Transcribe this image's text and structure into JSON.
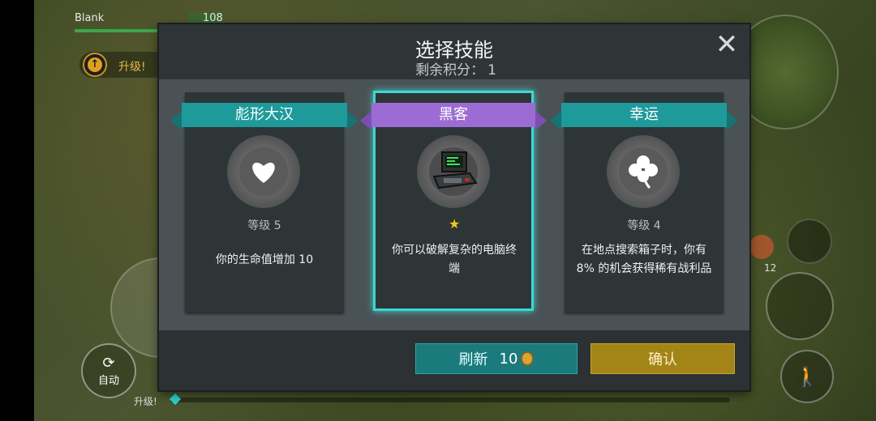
{
  "hud": {
    "player_name": "Blank",
    "hp_value": "108",
    "level_up_label": "升级!",
    "auto_label": "自动",
    "xp_label": "升级!",
    "item_count": "12"
  },
  "dialog": {
    "title": "选择技能",
    "points_label": "剩余积分：",
    "points_value": "1",
    "refresh_label": "刷新",
    "refresh_cost": "10",
    "confirm_label": "确认"
  },
  "cards": [
    {
      "name": "彪形大汉",
      "level": "等级 5",
      "description": "你的生命值增加 10",
      "icon": "heart-icon",
      "ribbon_color": "#1e9a9a"
    },
    {
      "name": "黑客",
      "level": "",
      "description_line1": "你可以破解复杂的电脑终",
      "description_line2": "端",
      "icon": "computer-terminal-icon",
      "ribbon_color": "#9c6cd4",
      "selected": true
    },
    {
      "name": "幸运",
      "level": "等级 4",
      "description_line1": "在地点搜索箱子时，你有",
      "description_line2": "8% 的机会获得稀有战利品",
      "icon": "clover-icon",
      "ribbon_color": "#1e9a9a"
    }
  ],
  "colors": {
    "teal": "#1e9a9a",
    "purple": "#9c6cd4",
    "selected_border": "#3fd6d0",
    "confirm": "#a38417",
    "refresh": "#1b7a7c"
  }
}
